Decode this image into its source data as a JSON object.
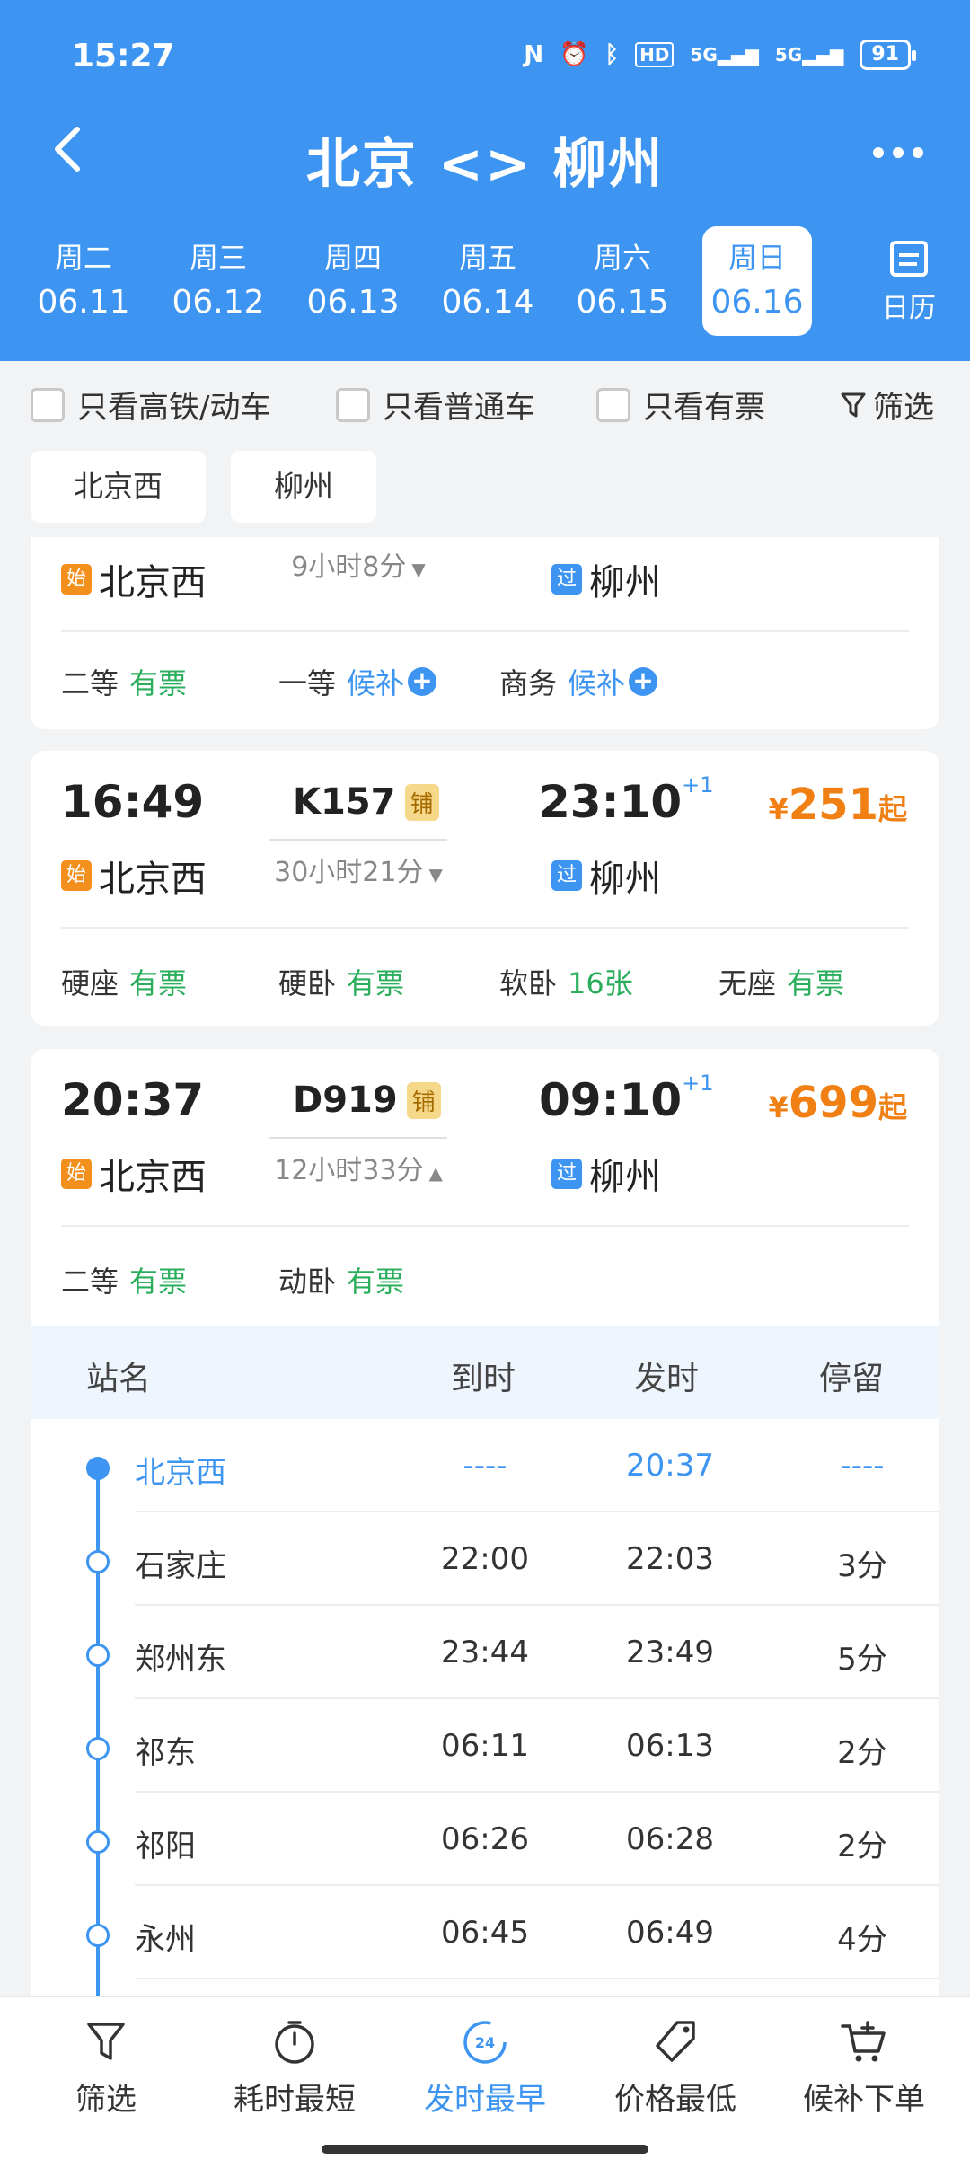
{
  "status": {
    "time": "15:27",
    "battery": "91"
  },
  "header": {
    "title": "北京 <> 柳州",
    "dates": [
      {
        "weekday": "周二",
        "date": "06.11"
      },
      {
        "weekday": "周三",
        "date": "06.12"
      },
      {
        "weekday": "周四",
        "date": "06.13"
      },
      {
        "weekday": "周五",
        "date": "06.14"
      },
      {
        "weekday": "周六",
        "date": "06.15"
      },
      {
        "weekday": "周日",
        "date": "06.16",
        "selected": true
      }
    ],
    "calendar_label": "日历"
  },
  "filters": {
    "high_speed_only": "只看高铁/动车",
    "regular_only": "只看普通车",
    "available_only": "只看有票",
    "filter_label": "筛选"
  },
  "station_tabs": [
    "北京西",
    "柳州"
  ],
  "cards": [
    {
      "dep_station": "北京西",
      "start_tag": "始",
      "duration": "9小时8分",
      "arr_station": "柳州",
      "pass_tag": "过",
      "seats": [
        {
          "class": "二等",
          "status": "有票"
        },
        {
          "class": "一等",
          "status": "候补"
        },
        {
          "class": "商务",
          "status": "候补"
        }
      ]
    },
    {
      "dep_time": "16:49",
      "train_no": "K157",
      "badge": "铺",
      "arr_time": "23:10",
      "day_offset": "+1",
      "price_yen": "¥",
      "price": "251",
      "price_suffix": "起",
      "dep_station": "北京西",
      "start_tag": "始",
      "duration": "30小时21分",
      "arr_station": "柳州",
      "pass_tag": "过",
      "seats": [
        {
          "class": "硬座",
          "status": "有票"
        },
        {
          "class": "硬卧",
          "status": "有票"
        },
        {
          "class": "软卧",
          "status": "16张"
        },
        {
          "class": "无座",
          "status": "有票"
        }
      ]
    },
    {
      "dep_time": "20:37",
      "train_no": "D919",
      "badge": "铺",
      "arr_time": "09:10",
      "day_offset": "+1",
      "price_yen": "¥",
      "price": "699",
      "price_suffix": "起",
      "dep_station": "北京西",
      "start_tag": "始",
      "duration": "12小时33分",
      "arr_station": "柳州",
      "pass_tag": "过",
      "seats": [
        {
          "class": "二等",
          "status": "有票"
        },
        {
          "class": "动卧",
          "status": "有票"
        }
      ],
      "stops_header": {
        "station": "站名",
        "arrive": "到时",
        "depart": "发时",
        "stay": "停留"
      },
      "stops": [
        {
          "station": "北京西",
          "arrive": "----",
          "depart": "20:37",
          "stay": "----"
        },
        {
          "station": "石家庄",
          "arrive": "22:00",
          "depart": "22:03",
          "stay": "3分"
        },
        {
          "station": "郑州东",
          "arrive": "23:44",
          "depart": "23:49",
          "stay": "5分"
        },
        {
          "station": "祁东",
          "arrive": "06:11",
          "depart": "06:13",
          "stay": "2分"
        },
        {
          "station": "祁阳",
          "arrive": "06:26",
          "depart": "06:28",
          "stay": "2分"
        },
        {
          "station": "永州",
          "arrive": "06:45",
          "depart": "06:49",
          "stay": "4分"
        }
      ]
    }
  ],
  "bottom_nav": [
    {
      "label": "筛选",
      "icon": "funnel-icon"
    },
    {
      "label": "耗时最短",
      "icon": "timer-icon"
    },
    {
      "label": "发时最早",
      "icon": "clock-24-icon",
      "active": true,
      "icon_text": "24"
    },
    {
      "label": "价格最低",
      "icon": "price-tag-icon"
    },
    {
      "label": "候补下单",
      "icon": "cart-plus-icon"
    }
  ],
  "colors": {
    "primary": "#3d95f1",
    "available": "#2aae5b",
    "price": "#f07f14",
    "start_tag": "#f3901d"
  }
}
